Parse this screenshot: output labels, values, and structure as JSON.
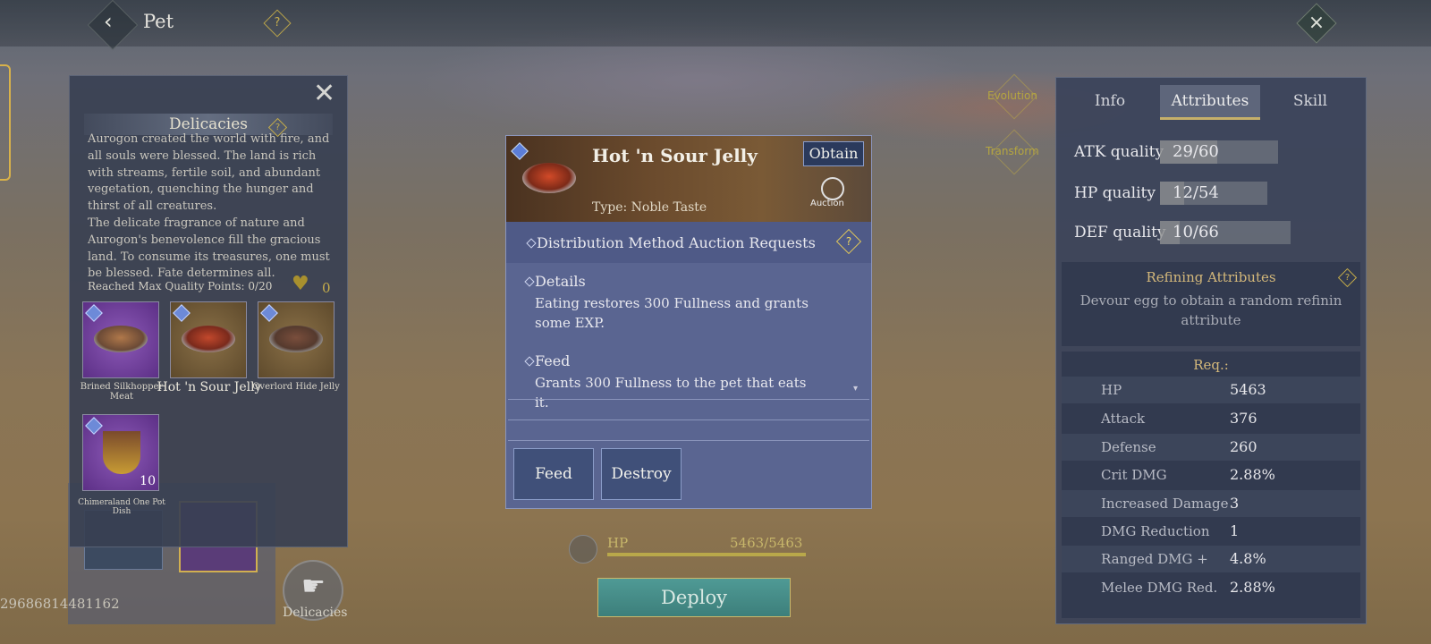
{
  "header": {
    "title": "Pet",
    "back_icon": "back-arrow-icon",
    "help_icon": "?",
    "close_icon": "close-icon"
  },
  "side_buttons": {
    "evolution": "Evolution",
    "transform": "Transform"
  },
  "pet": {
    "id_number": "29686814481162",
    "hp_label": "HP",
    "hp_value": "5463/5463",
    "hp_fraction": 1.0,
    "deploy_label": "Deploy"
  },
  "delicacies_tab": {
    "label": "Delicacies"
  },
  "delicacies_panel": {
    "title": "Delicacies",
    "description_1": "Aurogon created the world with fire, and all souls were blessed. The land is rich with streams, fertile soil, and abundant vegetation, quenching the hunger and thirst of all creatures.",
    "description_2": "The delicate fragrance of nature and Aurogon's benevolence fill the gracious land. To consume its treasures, one must be blessed. Fate determines all.",
    "quality_points": "Reached Max Quality Points: 0/20",
    "heart_count": "0",
    "items": [
      {
        "name": "Brined Silkhopper Meat"
      },
      {
        "name": "Hot 'n Sour Jelly"
      },
      {
        "name": "Overlord Hide Jelly"
      },
      {
        "name": "Chimeraland One Pot Dish",
        "count": "10"
      }
    ]
  },
  "item_detail": {
    "name": "Hot 'n Sour Jelly",
    "obtain_label": "Obtain",
    "auction_label": "Auction",
    "type": "Type: Noble Taste",
    "distribution_label": "Distribution Method",
    "distribution_value": "Auction Requests",
    "details_title": "Details",
    "details_body": "Eating restores 300 Fullness and grants some EXP.",
    "feed_title": "Feed",
    "feed_body": "Grants 300 Fullness to the pet that eats it.",
    "feed_button": "Feed",
    "destroy_button": "Destroy"
  },
  "attributes_panel": {
    "tabs": [
      "Info",
      "Attributes",
      "Skill"
    ],
    "active_tab": "Attributes",
    "qualities": [
      {
        "label": "ATK quality",
        "value": "29/60",
        "fraction": 0.483
      },
      {
        "label": "HP quality",
        "value": "12/54",
        "fraction": 0.222
      },
      {
        "label": "DEF quality",
        "value": "10/66",
        "fraction": 0.152
      }
    ],
    "refining_title": "Refining Attributes",
    "refining_desc": "Devour egg to obtain a random refinin attribute",
    "req_title": "Req.:",
    "req_rows": [
      {
        "name": "HP",
        "value": "5463"
      },
      {
        "name": "Attack",
        "value": "376"
      },
      {
        "name": "Defense",
        "value": "260"
      },
      {
        "name": "Crit DMG",
        "value": "2.88%"
      },
      {
        "name": "Increased Damage",
        "value": "3"
      },
      {
        "name": "DMG Reduction",
        "value": "1"
      },
      {
        "name": "Ranged DMG +",
        "value": "4.8%"
      },
      {
        "name": "Melee DMG Red.",
        "value": "2.88%"
      }
    ]
  }
}
